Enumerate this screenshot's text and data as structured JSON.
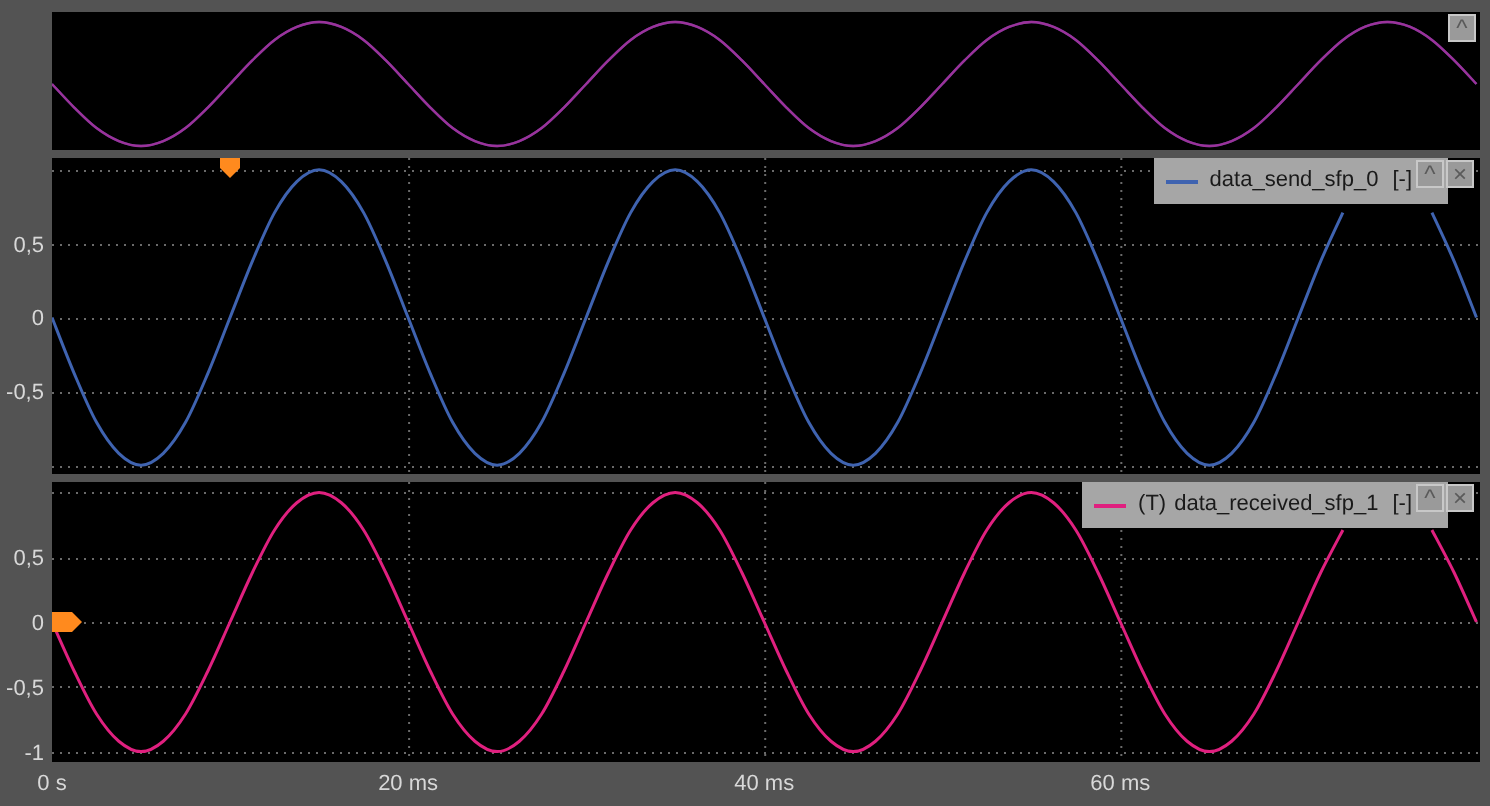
{
  "overview": {
    "kind": "picture",
    "collapse_button": "^"
  },
  "panels": [
    {
      "legend": {
        "suffix": "[-]"
      },
      "collapse_button": "^",
      "close_button": "×",
      "chart_data": {
        "type": "line",
        "grid": true,
        "xlim": [
          0,
          80.2
        ],
        "ylim": [
          -1.06,
          1.08
        ],
        "yticks": [
          {
            "value": 0.5,
            "label": "0,5"
          },
          {
            "value": 0,
            "label": "0"
          },
          {
            "value": -0.5,
            "label": "-0,5"
          }
        ],
        "x": [
          0,
          1.25,
          2.5,
          3.75,
          5,
          6.25,
          7.5,
          8.75,
          10,
          11.25,
          12.5,
          13.75,
          15,
          16.25,
          17.5,
          18.75,
          20,
          21.25,
          22.5,
          23.75,
          25,
          26.25,
          27.5,
          28.75,
          30,
          31.25,
          32.5,
          33.75,
          35,
          36.25,
          37.5,
          38.75,
          40,
          41.25,
          42.5,
          43.75,
          45,
          46.25,
          47.5,
          48.75,
          50,
          51.25,
          52.5,
          53.75,
          55,
          56.25,
          57.5,
          58.75,
          60,
          61.25,
          62.5,
          63.75,
          65,
          66.25,
          67.5,
          68.75,
          70,
          71.25,
          72.5,
          73.75,
          75,
          76.25,
          77.5,
          78.75,
          80
        ],
        "series": [
          {
            "name": "data_send_sfp_0",
            "color": "#3f63b0",
            "values": [
              0,
              -0.38,
              -0.71,
              -0.92,
              -1,
              -0.92,
              -0.71,
              -0.38,
              0,
              0.38,
              0.71,
              0.92,
              1,
              0.92,
              0.71,
              0.38,
              0,
              -0.38,
              -0.71,
              -0.92,
              -1,
              -0.92,
              -0.71,
              -0.38,
              0,
              0.38,
              0.71,
              0.92,
              1,
              0.92,
              0.71,
              0.38,
              0,
              -0.38,
              -0.71,
              -0.92,
              -1,
              -0.92,
              -0.71,
              -0.38,
              0,
              0.38,
              0.71,
              0.92,
              1,
              0.92,
              0.71,
              0.38,
              0,
              -0.38,
              -0.71,
              -0.92,
              -1,
              -0.92,
              -0.71,
              -0.38,
              0,
              0.38,
              0.71,
              null,
              null,
              null,
              0.71,
              0.38,
              0
            ]
          }
        ]
      }
    },
    {
      "legend": {
        "prefix": "(T)",
        "suffix": "[-]"
      },
      "collapse_button": "^",
      "close_button": "×",
      "chart_data": {
        "type": "line",
        "grid": true,
        "xlim": [
          0,
          80.2
        ],
        "ylim": [
          -1.08,
          1.08
        ],
        "yticks": [
          {
            "value": 0.5,
            "label": "0,5"
          },
          {
            "value": 0,
            "label": "0"
          },
          {
            "value": -0.5,
            "label": "-0,5"
          },
          {
            "value": -1,
            "label": "-1"
          }
        ],
        "xticks": [
          {
            "value": 0,
            "label": "0 s"
          },
          {
            "value": 20,
            "label": "20 ms"
          },
          {
            "value": 40,
            "label": "40 ms"
          },
          {
            "value": 60,
            "label": "60 ms"
          }
        ],
        "x": [
          0,
          1.25,
          2.5,
          3.75,
          5,
          6.25,
          7.5,
          8.75,
          10,
          11.25,
          12.5,
          13.75,
          15,
          16.25,
          17.5,
          18.75,
          20,
          21.25,
          22.5,
          23.75,
          25,
          26.25,
          27.5,
          28.75,
          30,
          31.25,
          32.5,
          33.75,
          35,
          36.25,
          37.5,
          38.75,
          40,
          41.25,
          42.5,
          43.75,
          45,
          46.25,
          47.5,
          48.75,
          50,
          51.25,
          52.5,
          53.75,
          55,
          56.25,
          57.5,
          58.75,
          60,
          61.25,
          62.5,
          63.75,
          65,
          66.25,
          67.5,
          68.75,
          70,
          71.25,
          72.5,
          73.75,
          75,
          76.25,
          77.5,
          78.75,
          80
        ],
        "series": [
          {
            "name": "data_received_sfp_1",
            "color": "#e0207f",
            "values": [
              0,
              -0.38,
              -0.71,
              -0.92,
              -1,
              -0.92,
              -0.71,
              -0.38,
              0,
              0.38,
              0.71,
              0.92,
              1,
              0.92,
              0.71,
              0.38,
              0,
              -0.38,
              -0.71,
              -0.92,
              -1,
              -0.92,
              -0.71,
              -0.38,
              0,
              0.38,
              0.71,
              0.92,
              1,
              0.92,
              0.71,
              0.38,
              0,
              -0.38,
              -0.71,
              -0.92,
              -1,
              -0.92,
              -0.71,
              -0.38,
              0,
              0.38,
              0.71,
              0.92,
              1,
              0.92,
              0.71,
              0.38,
              0,
              -0.38,
              -0.71,
              -0.92,
              -1,
              -0.92,
              -0.71,
              -0.38,
              0,
              0.38,
              0.71,
              null,
              null,
              null,
              0.71,
              0.38,
              0
            ]
          }
        ]
      }
    }
  ]
}
